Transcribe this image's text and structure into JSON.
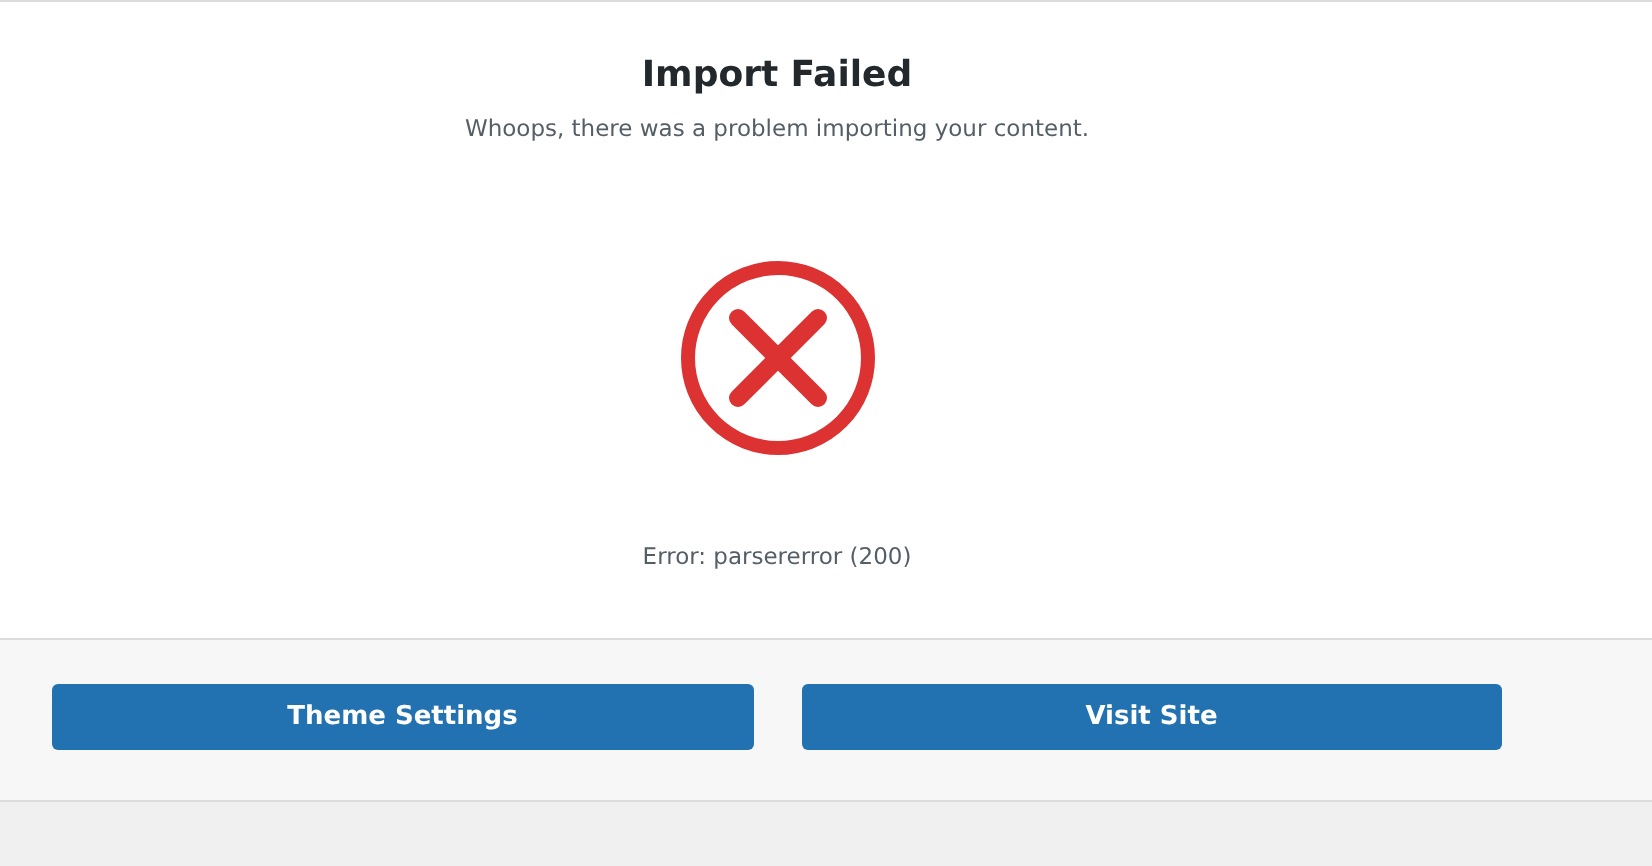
{
  "title": "Import Failed",
  "message": "Whoops, there was a problem importing your content.",
  "failed": true,
  "error": "Error: parsererror (200)",
  "buttons": [
    {
      "label": "Theme Settings"
    },
    {
      "label": "Visit Site"
    }
  ]
}
